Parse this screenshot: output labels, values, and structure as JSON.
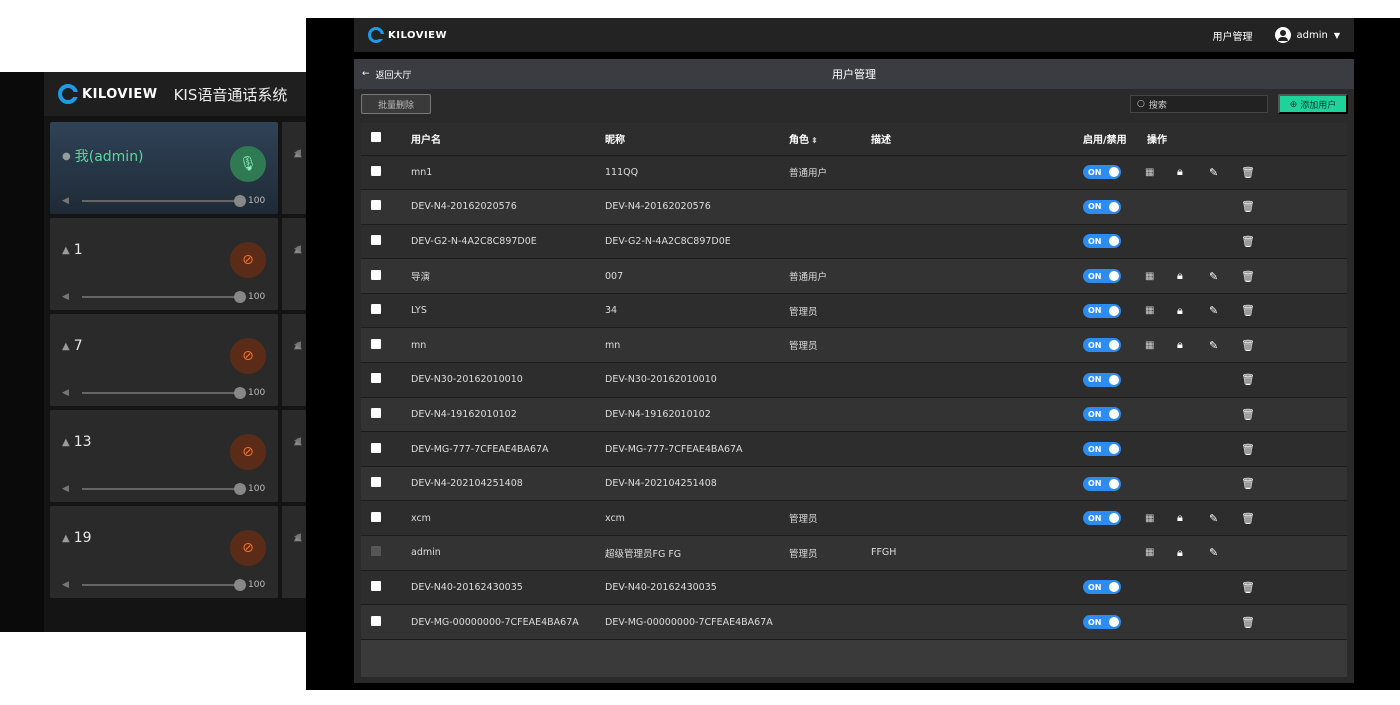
{
  "back_window": {
    "logo_text": "KILOVIEW",
    "title": "KIS语音通话系统",
    "cards": [
      {
        "name": "我(admin)",
        "volume": "100",
        "active": true
      },
      {
        "name": "1",
        "volume": "100",
        "active": false
      },
      {
        "name": "7",
        "volume": "100",
        "active": false
      },
      {
        "name": "13",
        "volume": "100",
        "active": false
      },
      {
        "name": "19",
        "volume": "100",
        "active": false
      }
    ]
  },
  "topbar": {
    "logo_text": "KILOVIEW",
    "menu_user_mgmt": "用户管理",
    "username": "admin"
  },
  "panel": {
    "back_label": "返回大厅",
    "title": "用户管理",
    "batch_delete": "批量删除",
    "search_placeholder": "搜索",
    "add_user": "添加用户"
  },
  "table": {
    "headers": {
      "username": "用户名",
      "nickname": "昵称",
      "role": "角色",
      "desc": "描述",
      "enable": "启用/禁用",
      "ops": "操作"
    },
    "toggle_label": "ON",
    "rows": [
      {
        "username": "mn1",
        "nickname": "111QQ",
        "role": "普通用户",
        "desc": "",
        "toggle": true,
        "qr": true,
        "lock": true,
        "edit": true,
        "del": true
      },
      {
        "username": "DEV-N4-20162020576",
        "nickname": "DEV-N4-20162020576",
        "role": "",
        "desc": "",
        "toggle": true,
        "qr": false,
        "lock": false,
        "edit": false,
        "del": true
      },
      {
        "username": "DEV-G2-N-4A2C8C897D0E",
        "nickname": "DEV-G2-N-4A2C8C897D0E",
        "role": "",
        "desc": "",
        "toggle": true,
        "qr": false,
        "lock": false,
        "edit": false,
        "del": true
      },
      {
        "username": "导演",
        "nickname": "007",
        "role": "普通用户",
        "desc": "",
        "toggle": true,
        "qr": true,
        "lock": true,
        "edit": true,
        "del": true
      },
      {
        "username": "LYS",
        "nickname": "34",
        "role": "管理员",
        "desc": "",
        "toggle": true,
        "qr": true,
        "lock": true,
        "edit": true,
        "del": true
      },
      {
        "username": "mn",
        "nickname": "mn",
        "role": "管理员",
        "desc": "",
        "toggle": true,
        "qr": true,
        "lock": true,
        "edit": true,
        "del": true
      },
      {
        "username": "DEV-N30-20162010010",
        "nickname": "DEV-N30-20162010010",
        "role": "",
        "desc": "",
        "toggle": true,
        "qr": false,
        "lock": false,
        "edit": false,
        "del": true
      },
      {
        "username": "DEV-N4-19162010102",
        "nickname": "DEV-N4-19162010102",
        "role": "",
        "desc": "",
        "toggle": true,
        "qr": false,
        "lock": false,
        "edit": false,
        "del": true
      },
      {
        "username": "DEV-MG-777-7CFEAE4BA67A",
        "nickname": "DEV-MG-777-7CFEAE4BA67A",
        "role": "",
        "desc": "",
        "toggle": true,
        "qr": false,
        "lock": false,
        "edit": false,
        "del": true
      },
      {
        "username": "DEV-N4-202104251408",
        "nickname": "DEV-N4-202104251408",
        "role": "",
        "desc": "",
        "toggle": true,
        "qr": false,
        "lock": false,
        "edit": false,
        "del": true
      },
      {
        "username": "xcm",
        "nickname": "xcm",
        "role": "管理员",
        "desc": "",
        "toggle": true,
        "qr": true,
        "lock": true,
        "edit": true,
        "del": true
      },
      {
        "username": "admin",
        "nickname": "超级管理员FG FG",
        "role": "管理员",
        "desc": "FFGH",
        "toggle": false,
        "qr": true,
        "lock": true,
        "edit": true,
        "del": false,
        "checkbox_disabled": true
      },
      {
        "username": "DEV-N40-20162430035",
        "nickname": "DEV-N40-20162430035",
        "role": "",
        "desc": "",
        "toggle": true,
        "qr": false,
        "lock": false,
        "edit": false,
        "del": true
      },
      {
        "username": "DEV-MG-00000000-7CFEAE4BA67A",
        "nickname": "DEV-MG-00000000-7CFEAE4BA67A",
        "role": "",
        "desc": "",
        "toggle": true,
        "qr": false,
        "lock": false,
        "edit": false,
        "del": true
      }
    ]
  },
  "colors": {
    "accent": "#2d8cf0",
    "add_button": "#1ed39a",
    "mic_active": "#2f7a52",
    "mic_muted": "#ff6d2a"
  }
}
